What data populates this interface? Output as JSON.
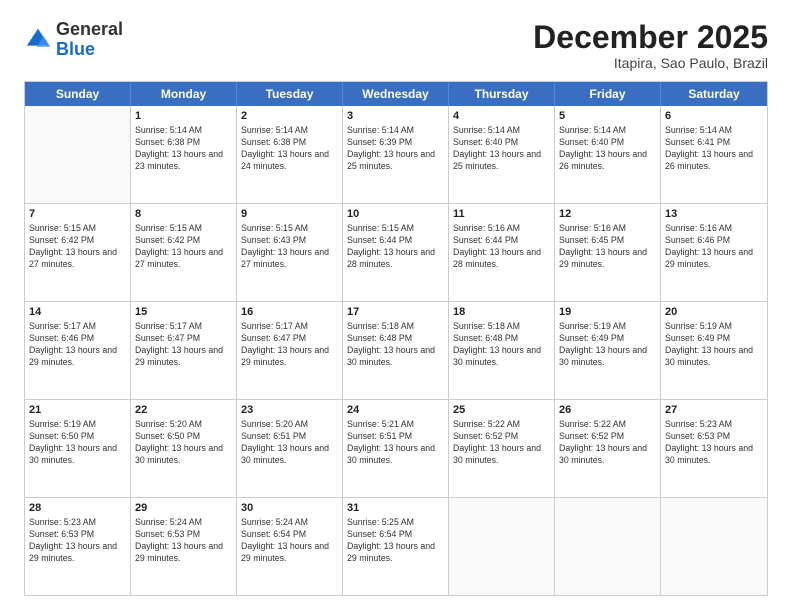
{
  "header": {
    "logo": {
      "line1": "General",
      "line2": "Blue"
    },
    "title": "December 2025",
    "location": "Itapira, Sao Paulo, Brazil"
  },
  "calendar": {
    "days_of_week": [
      "Sunday",
      "Monday",
      "Tuesday",
      "Wednesday",
      "Thursday",
      "Friday",
      "Saturday"
    ],
    "weeks": [
      [
        {
          "day": "",
          "empty": true
        },
        {
          "day": "1",
          "sunrise": "5:14 AM",
          "sunset": "6:38 PM",
          "daylight": "13 hours and 23 minutes."
        },
        {
          "day": "2",
          "sunrise": "5:14 AM",
          "sunset": "6:38 PM",
          "daylight": "13 hours and 24 minutes."
        },
        {
          "day": "3",
          "sunrise": "5:14 AM",
          "sunset": "6:39 PM",
          "daylight": "13 hours and 25 minutes."
        },
        {
          "day": "4",
          "sunrise": "5:14 AM",
          "sunset": "6:40 PM",
          "daylight": "13 hours and 25 minutes."
        },
        {
          "day": "5",
          "sunrise": "5:14 AM",
          "sunset": "6:40 PM",
          "daylight": "13 hours and 26 minutes."
        },
        {
          "day": "6",
          "sunrise": "5:14 AM",
          "sunset": "6:41 PM",
          "daylight": "13 hours and 26 minutes."
        }
      ],
      [
        {
          "day": "7",
          "sunrise": "5:15 AM",
          "sunset": "6:42 PM",
          "daylight": "13 hours and 27 minutes."
        },
        {
          "day": "8",
          "sunrise": "5:15 AM",
          "sunset": "6:42 PM",
          "daylight": "13 hours and 27 minutes."
        },
        {
          "day": "9",
          "sunrise": "5:15 AM",
          "sunset": "6:43 PM",
          "daylight": "13 hours and 27 minutes."
        },
        {
          "day": "10",
          "sunrise": "5:15 AM",
          "sunset": "6:44 PM",
          "daylight": "13 hours and 28 minutes."
        },
        {
          "day": "11",
          "sunrise": "5:16 AM",
          "sunset": "6:44 PM",
          "daylight": "13 hours and 28 minutes."
        },
        {
          "day": "12",
          "sunrise": "5:16 AM",
          "sunset": "6:45 PM",
          "daylight": "13 hours and 29 minutes."
        },
        {
          "day": "13",
          "sunrise": "5:16 AM",
          "sunset": "6:46 PM",
          "daylight": "13 hours and 29 minutes."
        }
      ],
      [
        {
          "day": "14",
          "sunrise": "5:17 AM",
          "sunset": "6:46 PM",
          "daylight": "13 hours and 29 minutes."
        },
        {
          "day": "15",
          "sunrise": "5:17 AM",
          "sunset": "6:47 PM",
          "daylight": "13 hours and 29 minutes."
        },
        {
          "day": "16",
          "sunrise": "5:17 AM",
          "sunset": "6:47 PM",
          "daylight": "13 hours and 29 minutes."
        },
        {
          "day": "17",
          "sunrise": "5:18 AM",
          "sunset": "6:48 PM",
          "daylight": "13 hours and 30 minutes."
        },
        {
          "day": "18",
          "sunrise": "5:18 AM",
          "sunset": "6:48 PM",
          "daylight": "13 hours and 30 minutes."
        },
        {
          "day": "19",
          "sunrise": "5:19 AM",
          "sunset": "6:49 PM",
          "daylight": "13 hours and 30 minutes."
        },
        {
          "day": "20",
          "sunrise": "5:19 AM",
          "sunset": "6:49 PM",
          "daylight": "13 hours and 30 minutes."
        }
      ],
      [
        {
          "day": "21",
          "sunrise": "5:19 AM",
          "sunset": "6:50 PM",
          "daylight": "13 hours and 30 minutes."
        },
        {
          "day": "22",
          "sunrise": "5:20 AM",
          "sunset": "6:50 PM",
          "daylight": "13 hours and 30 minutes."
        },
        {
          "day": "23",
          "sunrise": "5:20 AM",
          "sunset": "6:51 PM",
          "daylight": "13 hours and 30 minutes."
        },
        {
          "day": "24",
          "sunrise": "5:21 AM",
          "sunset": "6:51 PM",
          "daylight": "13 hours and 30 minutes."
        },
        {
          "day": "25",
          "sunrise": "5:22 AM",
          "sunset": "6:52 PM",
          "daylight": "13 hours and 30 minutes."
        },
        {
          "day": "26",
          "sunrise": "5:22 AM",
          "sunset": "6:52 PM",
          "daylight": "13 hours and 30 minutes."
        },
        {
          "day": "27",
          "sunrise": "5:23 AM",
          "sunset": "6:53 PM",
          "daylight": "13 hours and 30 minutes."
        }
      ],
      [
        {
          "day": "28",
          "sunrise": "5:23 AM",
          "sunset": "6:53 PM",
          "daylight": "13 hours and 29 minutes."
        },
        {
          "day": "29",
          "sunrise": "5:24 AM",
          "sunset": "6:53 PM",
          "daylight": "13 hours and 29 minutes."
        },
        {
          "day": "30",
          "sunrise": "5:24 AM",
          "sunset": "6:54 PM",
          "daylight": "13 hours and 29 minutes."
        },
        {
          "day": "31",
          "sunrise": "5:25 AM",
          "sunset": "6:54 PM",
          "daylight": "13 hours and 29 minutes."
        },
        {
          "day": "",
          "empty": true
        },
        {
          "day": "",
          "empty": true
        },
        {
          "day": "",
          "empty": true
        }
      ]
    ]
  }
}
